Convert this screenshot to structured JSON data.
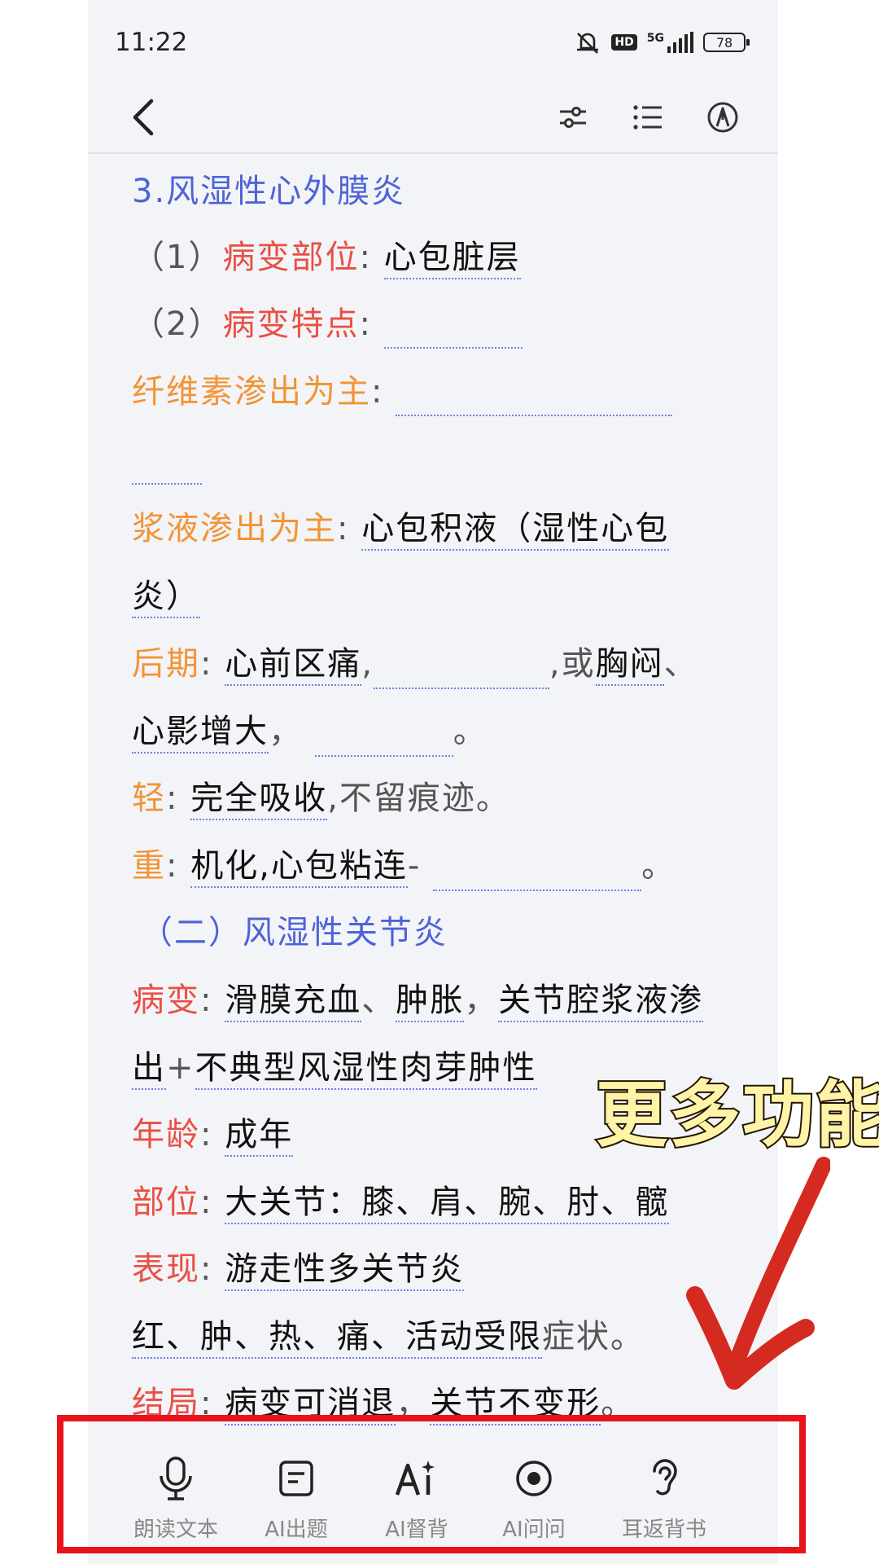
{
  "status_bar": {
    "time": "11:22",
    "hd": "HD",
    "network": "5G",
    "battery": "78"
  },
  "nav": {
    "back_icon": "chevron-left-icon",
    "icons": [
      "sliders-icon",
      "list-icon",
      "ai-pen-icon"
    ]
  },
  "content": {
    "heading_3": "3.风湿性心外膜炎",
    "site_num": "（1）",
    "site_label": "病变部位",
    "colon": ":",
    "site_answer": "心包脏层",
    "feature_num": "（2）",
    "feature_label": "病变特点",
    "fibrin_label": "纤维素渗出为主",
    "serous_label": "浆液渗出为主",
    "serous_answer_1": "心包积液（湿性心包",
    "serous_answer_2": "炎）",
    "late_label": "后期",
    "late_answer_1": "心前区痛",
    "comma": ",",
    "or_text": ",或",
    "late_answer_2": "胸闷",
    "dun": "、",
    "late_answer_3": "心影增大",
    "cn_comma": "，",
    "period": "。",
    "mild_label": "轻",
    "mild_answer": "完全吸收",
    "mild_tail": ",不留痕迹。",
    "severe_label": "重",
    "severe_answer": "机化,心包粘连",
    "dash": "-",
    "heading_2": "（二）风湿性关节炎",
    "lesion_label": "病变",
    "lesion_answer_1": "滑膜充血",
    "lesion_answer_2": "肿胀",
    "lesion_answer_3": "关节腔浆液渗",
    "lesion_answer_4": "出",
    "plus": "+",
    "lesion_answer_5": "不典型风湿性肉芽肿性",
    "age_label": "年龄",
    "age_answer": "成年",
    "part_label": "部位",
    "part_answer": "大关节：膝、肩、腕、肘、髋",
    "show_label": "表现",
    "show_answer_1": "游走性多关节炎",
    "show_answer_2": "红、肿、热、痛、活动受限",
    "show_tail": "症状。",
    "outcome_label": "结局",
    "outcome_answer_1": "病变可消退",
    "outcome_answer_2": "关节不变形"
  },
  "overlay": {
    "more_label": "更多功能",
    "arrow_color": "#d42a1f",
    "box_color": "#e8131b"
  },
  "toolbar": {
    "items": [
      {
        "label": "朗读文本",
        "icon": "microphone-icon"
      },
      {
        "label": "AI出题",
        "icon": "document-icon"
      },
      {
        "label": "AI督背",
        "icon": "ai-sparkle-icon"
      },
      {
        "label": "AI问问",
        "icon": "radio-circle-icon"
      },
      {
        "label": "耳返背书",
        "icon": "ear-icon"
      }
    ]
  },
  "colors": {
    "heading": "#4e63d8",
    "label_red": "#e94f45",
    "label_orange": "#f29436",
    "underline": "#6f7fe8"
  }
}
